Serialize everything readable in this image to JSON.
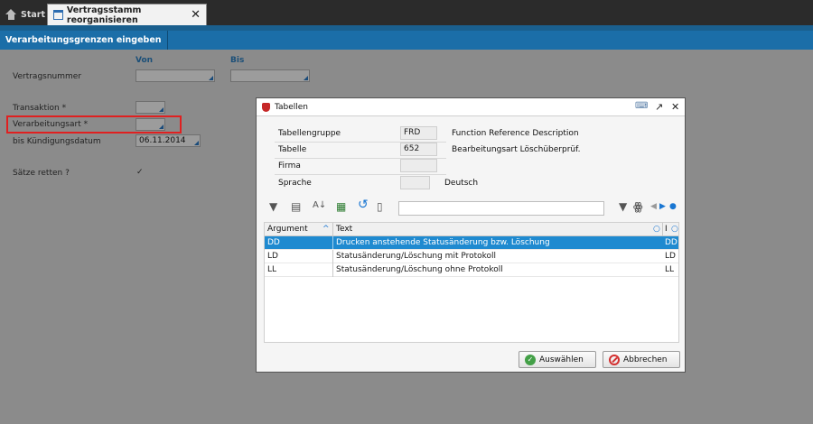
{
  "tabs": {
    "start_label": "Start",
    "active_label": "Vertragsstamm reorganisieren",
    "close_glyph": "✕"
  },
  "section_tab_label": "Verarbeitungsgrenzen eingeben",
  "form": {
    "col_from": "Von",
    "col_to": "Bis",
    "contract_no_label": "Vertragsnummer",
    "transaction_label": "Transaktion *",
    "processing_type_label": "Verarbeitungsart *",
    "termination_date_label": "bis Kündigungsdatum",
    "termination_date_value": "06.11.2014",
    "save_records_label": "Sätze retten ?",
    "save_records_checked": "✓"
  },
  "dialog": {
    "title": "Tabellen",
    "params": [
      {
        "label": "Tabellengruppe",
        "value": "FRD",
        "desc": "Function Reference Description"
      },
      {
        "label": "Tabelle",
        "value": "652",
        "desc": "Bearbeitungsart Löschüberprüf."
      },
      {
        "label": "Firma",
        "value": "",
        "desc": ""
      },
      {
        "label": "Sprache",
        "value": "",
        "desc": "Deutsch"
      }
    ],
    "table": {
      "headers": [
        "Argument",
        "Text",
        "I"
      ],
      "rows": [
        {
          "arg": "DD",
          "text": "Drucken anstehende Statusänderung bzw. Löschung",
          "i": "DD",
          "selected": true
        },
        {
          "arg": "LD",
          "text": "Statusänderung/Löschung mit Protokoll",
          "i": "LD",
          "selected": false
        },
        {
          "arg": "LL",
          "text": "Statusänderung/Löschung ohne Protokoll",
          "i": "LL",
          "selected": false
        }
      ]
    },
    "buttons": {
      "select_label": "Auswählen",
      "cancel_label": "Abbrechen"
    }
  },
  "colors": {
    "accent_blue": "#1b6ea8",
    "selection_blue": "#1f8ad0",
    "highlight_red": "#e02020"
  }
}
